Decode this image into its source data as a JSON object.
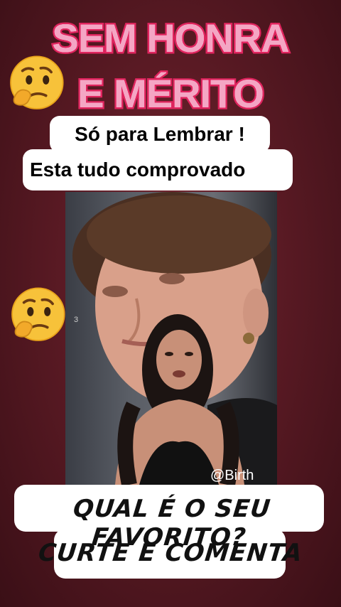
{
  "title": {
    "line1": "SEM HONRA",
    "line2": "E MÉRITO"
  },
  "captions": {
    "line1": "Só para Lembrar !",
    "line2": "Esta tudo comprovado"
  },
  "video": {
    "watermark": "@Birth",
    "side_number": "3"
  },
  "cta": {
    "line1": "QUAL É O SEU FAVORITO?",
    "line2": "CURTE E COMENTA"
  },
  "icons": {
    "top": "thinking-face-emoji",
    "middle": "thinking-face-emoji"
  },
  "colors": {
    "title_fill": "#f7b6cf",
    "title_stroke": "#e0245e",
    "background": "#5a1a24"
  }
}
